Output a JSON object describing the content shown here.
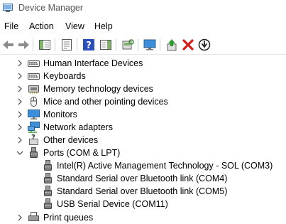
{
  "window": {
    "title": "Device Manager"
  },
  "menu": [
    "File",
    "Action",
    "View",
    "Help"
  ],
  "toolbar": {
    "buttons": [
      "back-icon",
      "forward-icon",
      "show-hide-console-tree-icon",
      "properties-icon",
      "help-icon",
      "action-pane-icon",
      "scan-hardware-icon",
      "monitor-icon",
      "update-driver-icon",
      "uninstall-icon",
      "disable-device-icon"
    ]
  },
  "tree": {
    "categories": [
      {
        "label": "Human Interface Devices",
        "icon": "keyboard-icon"
      },
      {
        "label": "Keyboards",
        "icon": "keyboard-icon"
      },
      {
        "label": "Memory technology devices",
        "icon": "memory-icon"
      },
      {
        "label": "Mice and other pointing devices",
        "icon": "mouse-icon"
      },
      {
        "label": "Monitors",
        "icon": "monitor-icon"
      },
      {
        "label": "Network adapters",
        "icon": "network-icon"
      },
      {
        "label": "Other devices",
        "icon": "unknown-device-icon"
      },
      {
        "label": "Ports (COM & LPT)",
        "icon": "port-icon",
        "expanded": true
      }
    ],
    "ports": [
      {
        "label": "Intel(R) Active Management Technology - SOL (COM3)"
      },
      {
        "label": "Standard Serial over Bluetooth link (COM4)"
      },
      {
        "label": "Standard Serial over Bluetooth link (COM5)"
      },
      {
        "label": "USB Serial Device (COM11)"
      }
    ],
    "after": [
      {
        "label": "Print queues",
        "icon": "printer-icon"
      }
    ]
  },
  "colors": {
    "accent": "#2e6fd0",
    "uninstall": "#d31e1e",
    "title_text": "#555555"
  }
}
